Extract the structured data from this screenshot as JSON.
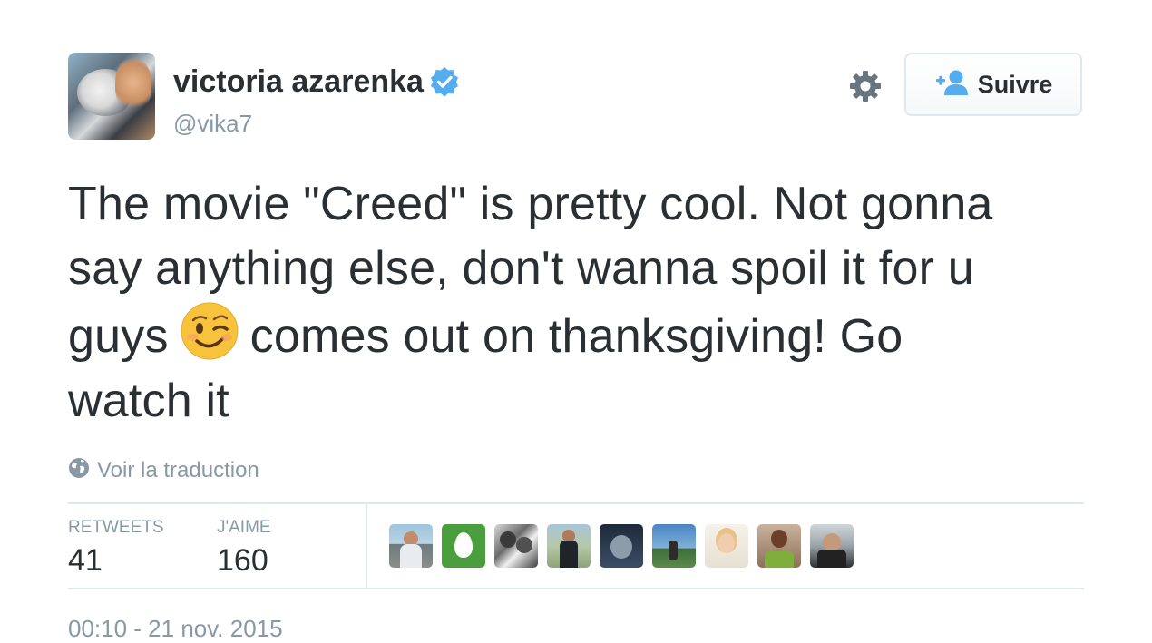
{
  "user": {
    "display_name": "victoria azarenka",
    "screen_name": "@vika7",
    "verified": true
  },
  "follow_button": {
    "label": "Suivre"
  },
  "tweet": {
    "text_line_1": "The movie \"Creed\" is pretty cool. Not gonna",
    "text_line_2": "say anything else, don't wanna spoil it for u",
    "text_line_3_before_emoji": "guys",
    "text_line_3_after_emoji": "comes out on thanksgiving! Go",
    "text_line_4": "watch it",
    "emoji": "winking-face-icon"
  },
  "translate_link": "Voir la traduction",
  "stats": {
    "retweets_label": "RETWEETS",
    "retweets_count": "41",
    "likes_label": "J'AIME",
    "likes_count": "160"
  },
  "likers_count_shown": 9,
  "timestamp": "00:10 - 21 nov. 2015",
  "colors": {
    "text": "#292f33",
    "secondary": "#8899a6",
    "border": "#e1e8ed",
    "verified_blue": "#55acee",
    "emoji_yellow": "#f7c33c"
  }
}
